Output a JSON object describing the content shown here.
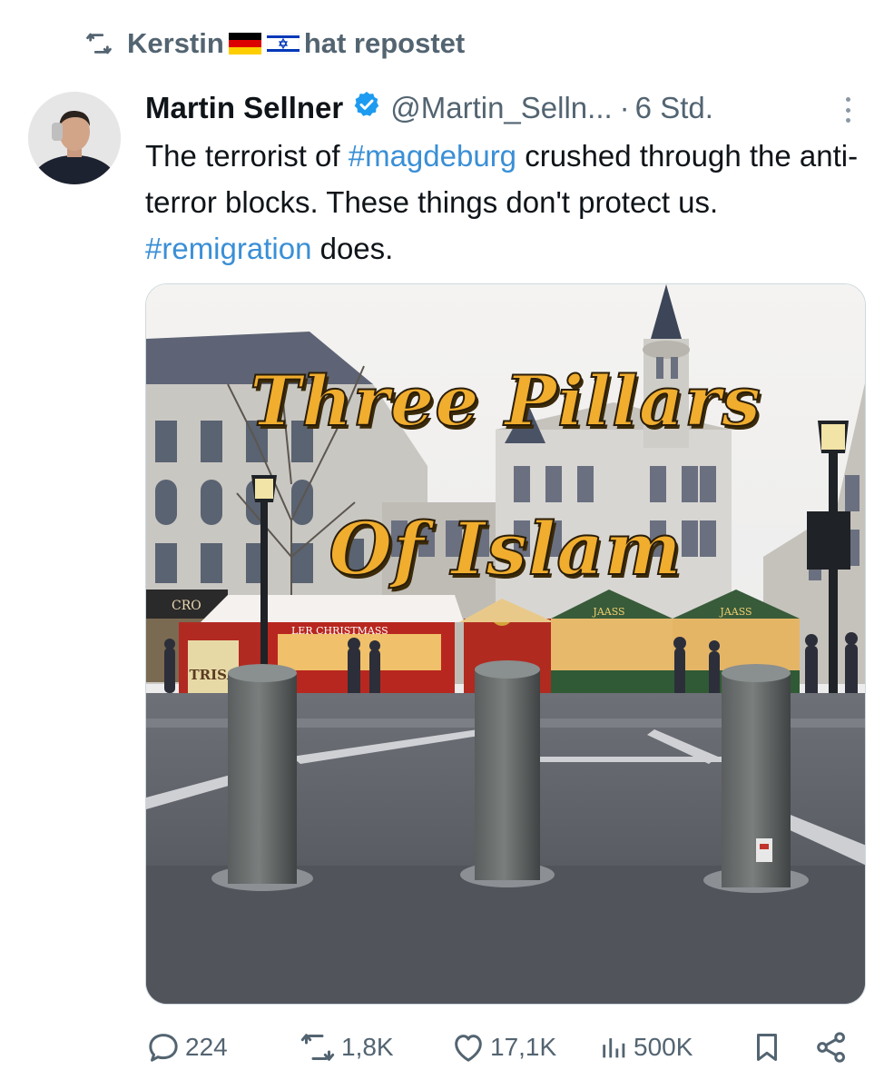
{
  "repost": {
    "user": "Kerstin",
    "flags": [
      "germany-flag",
      "israel-flag"
    ],
    "label": "hat repostet"
  },
  "tweet": {
    "author_name": "Martin Sellner",
    "handle": "@Martin_Selln...",
    "separator": "·",
    "time": "6 Std.",
    "text_parts": {
      "p1": "The terrorist of ",
      "hashtag1": "#magdeburg",
      "p2": " crushed through the anti-terror blocks. These things don't protect us. ",
      "hashtag2": "#remigration",
      "p3": " does."
    }
  },
  "media": {
    "title_line1": "Three Pillars",
    "title_line2": "Of Islam",
    "sign_store": "CRO",
    "sign_booth": "LER CHRISTMASS",
    "sign_stall1": "TRISA",
    "sign_hut1": "JAASS",
    "sign_hut2": "JAASS"
  },
  "actions": {
    "replies": "224",
    "reposts": "1,8K",
    "likes": "17,1K",
    "views": "500K"
  },
  "colors": {
    "hashtag": "#3a8fd6",
    "muted": "#536471",
    "verified": "#1d9bf0",
    "title_text": "#f0ad2e"
  }
}
